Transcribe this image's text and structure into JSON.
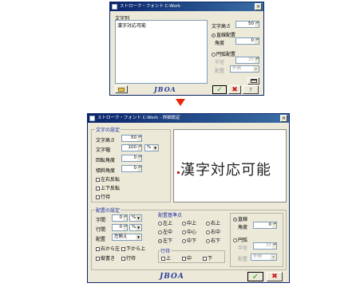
{
  "top_window": {
    "title": "ストローク・フォント C-Work",
    "text_group_label": "文字列",
    "text_value": "漢字対応可能",
    "char_height_label": "文字高さ",
    "char_height_value": "50",
    "linear_layout_label": "直線配置",
    "angle_label": "角度",
    "angle_value": "0",
    "arc_layout_label": "円弧配置",
    "radius_label": "半径",
    "radius_value": "25",
    "placement_label": "配置",
    "placement_value": "外側",
    "logo_text": "JBOA"
  },
  "bottom_window": {
    "title": "ストローク・フォント C-Work - 詳細設定",
    "char_settings_title": "文字の設定",
    "char_height_label": "文字高さ",
    "char_height_value": "50",
    "char_width_label": "文字幅",
    "char_width_value": "100",
    "char_width_unit": "%",
    "rotation_label": "回転角度",
    "rotation_value": "0",
    "slant_label": "傾斜角度",
    "slant_value": "0",
    "flip_h_label": "左右反転",
    "flip_v_label": "上下反転",
    "italic_label": "行待",
    "preview_text": "漢字対応可能",
    "layout_settings_title": "配置の設定",
    "char_spacing_label": "字間",
    "char_spacing_value": "0",
    "char_spacing_unit": "%",
    "line_spacing_label": "行間",
    "line_spacing_value": "0",
    "line_spacing_unit": "%",
    "align_label": "配置",
    "align_value": "左揃え",
    "rtl_label": "右から左",
    "btt_label": "下から上",
    "vertical_label": "縦書き",
    "indent_label": "行待",
    "anchor_title": "配置基準点",
    "anchors": [
      "左上",
      "中上",
      "右上",
      "左中",
      "中心",
      "右中",
      "左下",
      "中下",
      "右下"
    ],
    "row_title": "行待",
    "row_top": "上",
    "row_mid": "中",
    "row_bottom": "下",
    "linear_label": "直線",
    "angle_label": "角度",
    "angle_value": "0",
    "arc_label": "円弧",
    "radius_label": "半径",
    "radius_value": "25",
    "placement_label": "配置",
    "placement_value": "外側",
    "logo_text": "JBOA"
  },
  "colors": {
    "ok_check": "#1a9e1a",
    "cancel_x": "#d01818",
    "arrow": "#e8270a",
    "group_title": "#1f2f9f"
  }
}
